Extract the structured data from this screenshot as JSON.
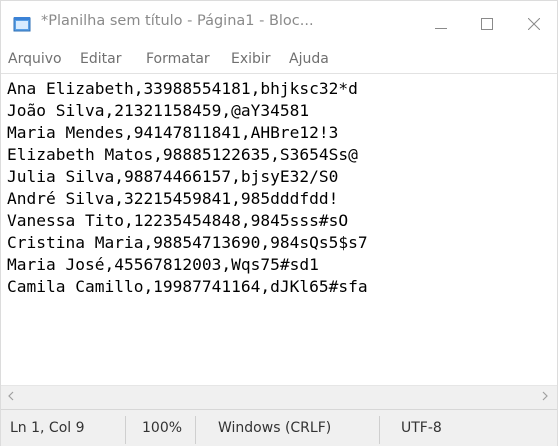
{
  "window": {
    "title": "*Planilha sem título - Página1 - Bloc...",
    "icon": "notepad-icon",
    "controls": {
      "minimize_icon": "minimize-icon",
      "maximize_icon": "maximize-icon",
      "close_icon": "close-icon"
    }
  },
  "menu": {
    "items": [
      {
        "label": "Arquivo"
      },
      {
        "label": "Editar"
      },
      {
        "label": "Formatar"
      },
      {
        "label": "Exibir"
      },
      {
        "label": "Ajuda"
      }
    ]
  },
  "editor": {
    "lines": [
      "Ana Elizabeth,33988554181,bhjksc32*d",
      "João Silva,21321158459,@aY34581",
      "Maria Mendes,94147811841,AHBre12!3",
      "Elizabeth Matos,98885122635,S3654Ss@",
      "Julia Silva,98874466157,bjsyE32/S0",
      "André Silva,32215459841,985dddfdd!",
      "Vanessa Tito,12235454848,9845sss#sO",
      "Cristina Maria,98854713690,984sQs5$s7",
      "Maria José,45567812003,Wqs75#sd1",
      "Camila Camillo,19987741164,dJKl65#sfa"
    ]
  },
  "scrollbar": {
    "left_icon": "scroll-left-icon",
    "right_icon": "scroll-right-icon"
  },
  "status": {
    "position": "Ln 1, Col 9",
    "zoom": "100%",
    "line_ending": "Windows (CRLF)",
    "encoding": "UTF-8"
  }
}
